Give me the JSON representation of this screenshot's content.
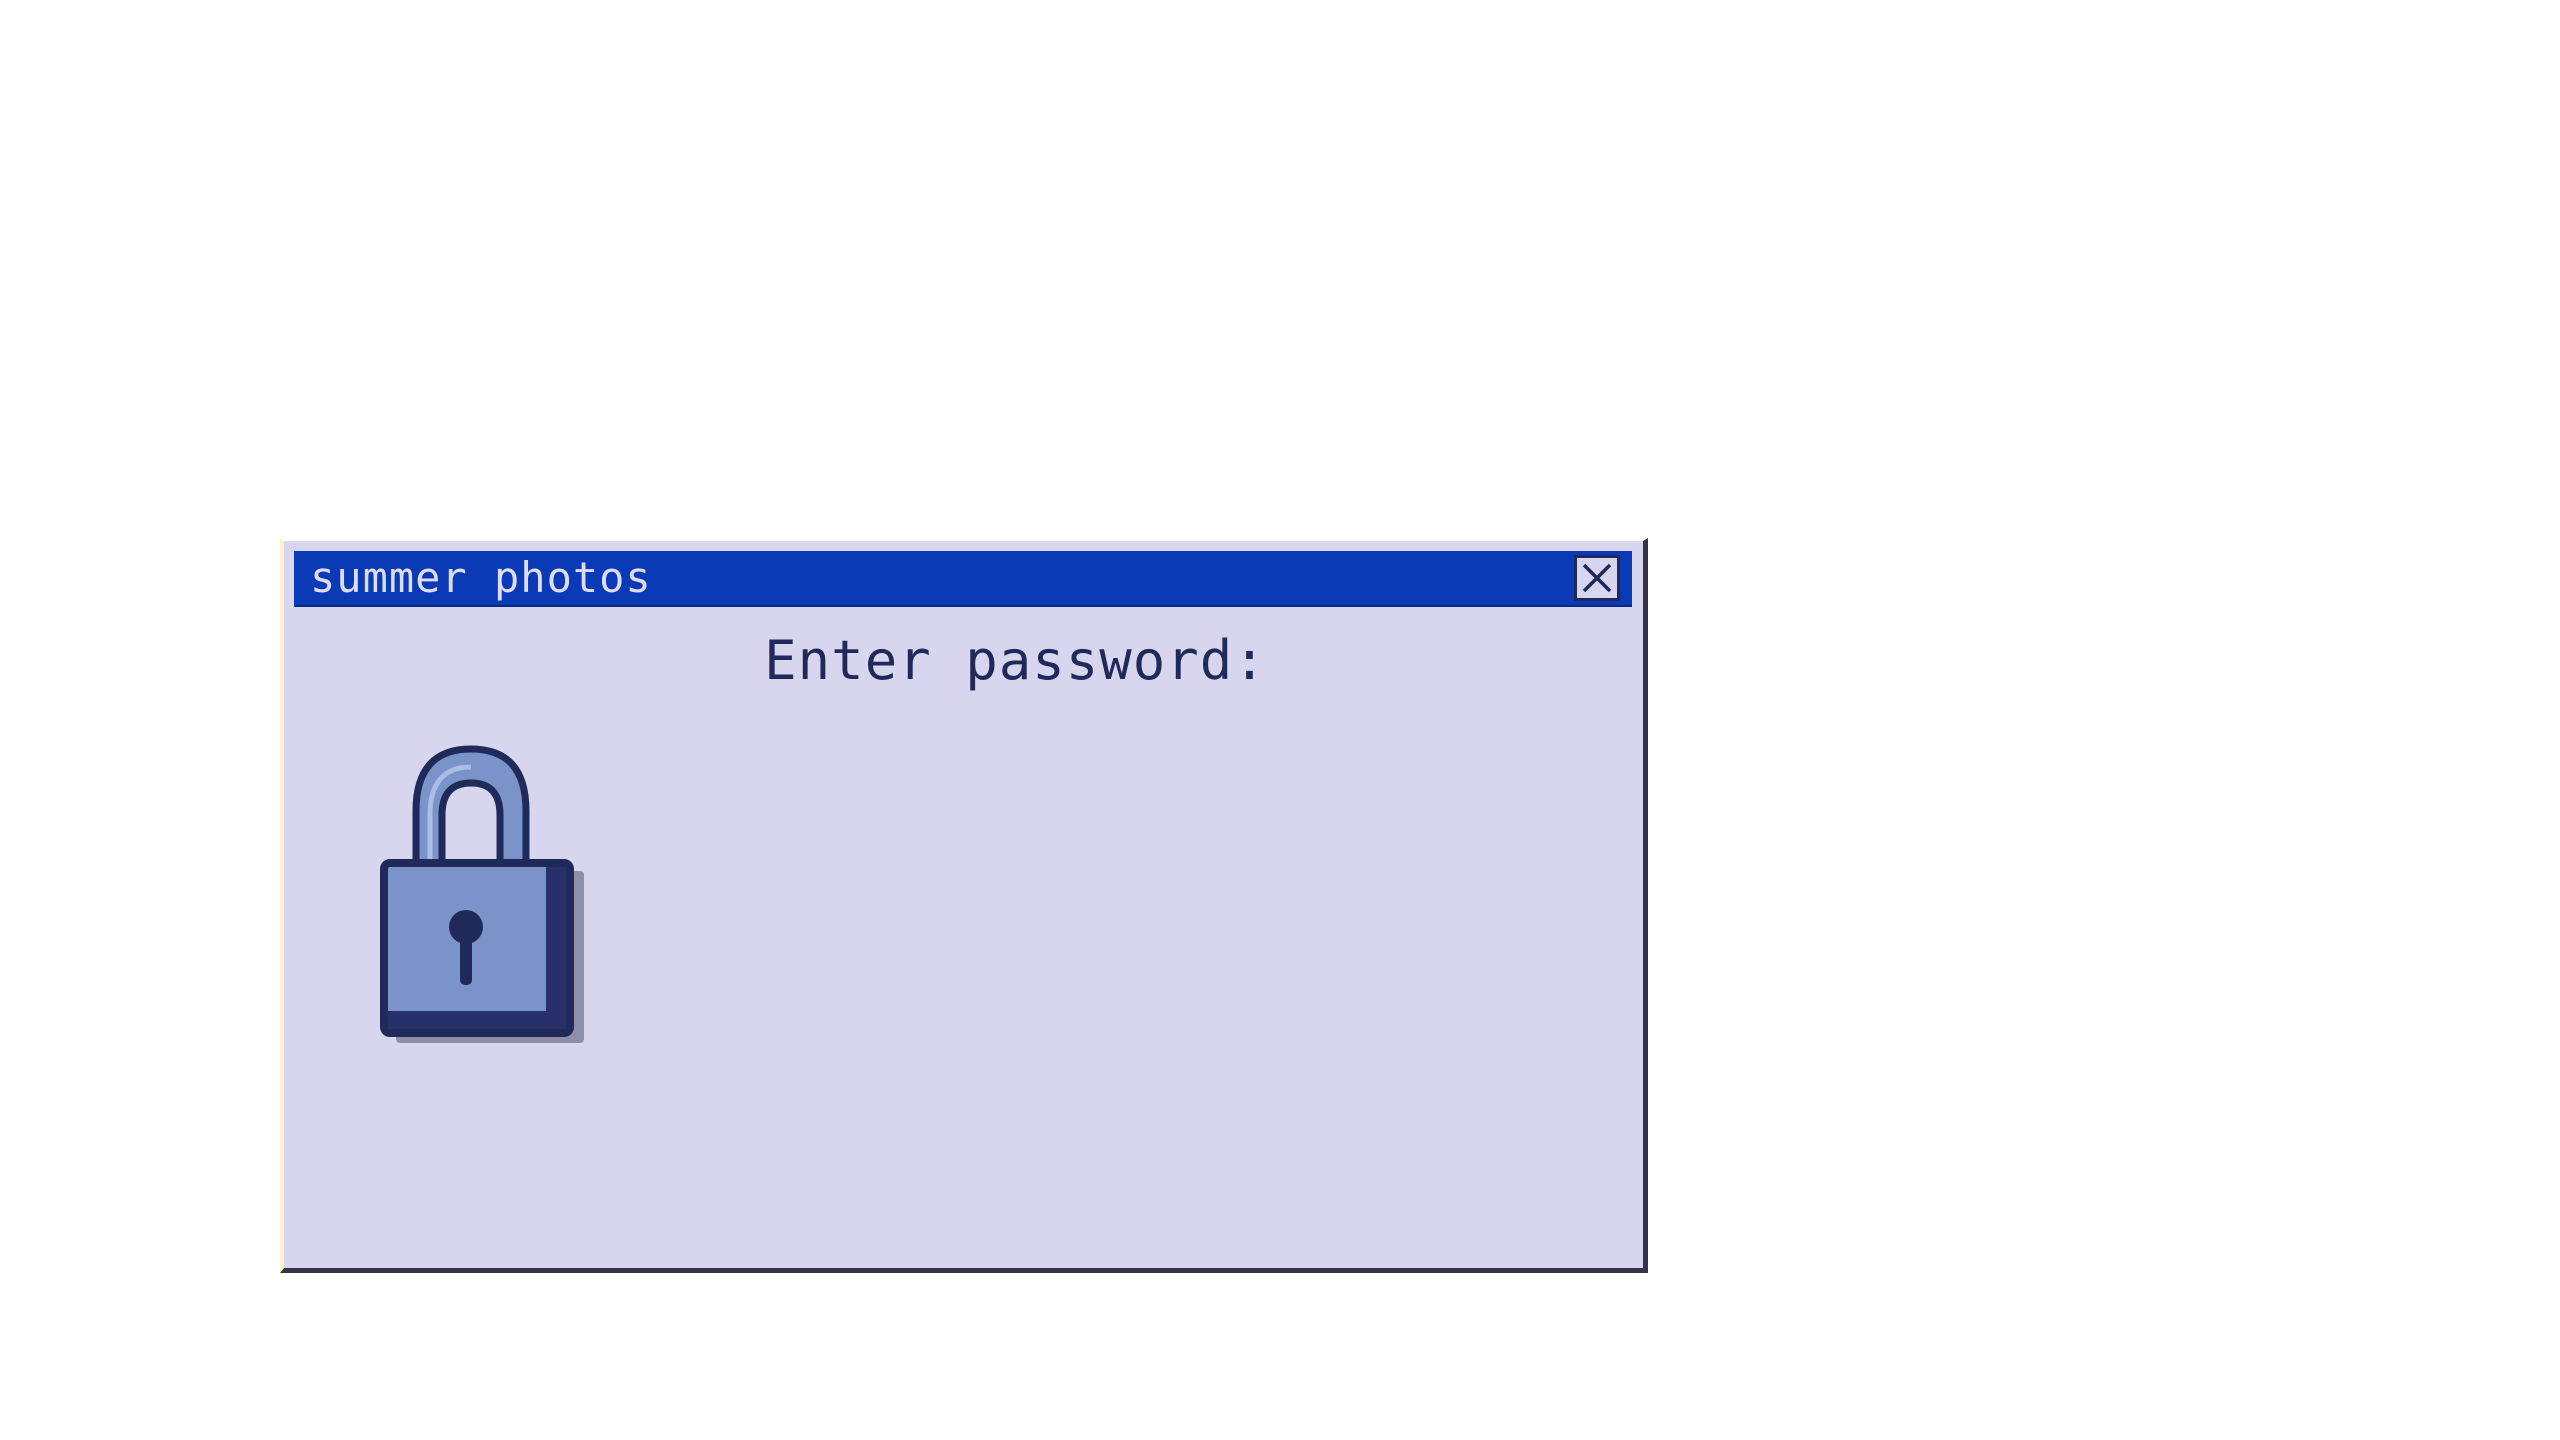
{
  "dialog": {
    "title": "summer photos",
    "close_icon": "close-icon",
    "prompt": "Enter password:",
    "lock_icon": "padlock-icon"
  },
  "colors": {
    "titlebar": "#0a3ab5",
    "dialog_background": "#d8d5ef",
    "text_dark": "#1f2a5a",
    "lock_body": "#7a93c8"
  }
}
